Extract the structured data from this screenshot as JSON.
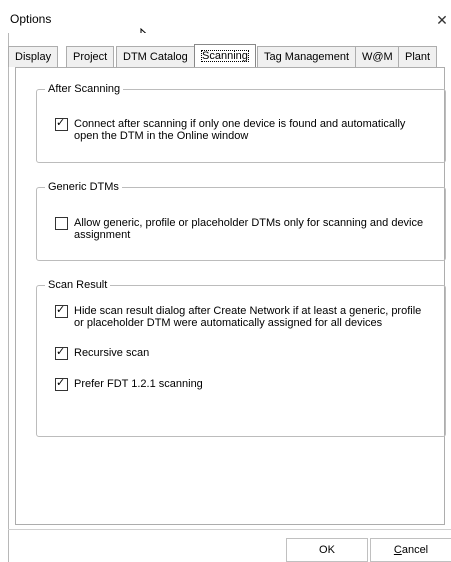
{
  "window": {
    "title": "Options",
    "close_glyph": "✕"
  },
  "tabs": [
    {
      "label": "Display"
    },
    {
      "label": "Project"
    },
    {
      "label": "DTM Catalog"
    },
    {
      "label": "Scanning",
      "active": true
    },
    {
      "label": "Tag Management"
    },
    {
      "label": "W@M"
    },
    {
      "label": "Plant"
    }
  ],
  "groups": {
    "after_scanning": {
      "legend": "After Scanning",
      "options": [
        {
          "line1": "Connect after scanning if only one device is found and automatically",
          "line2": "open the DTM in the Online window",
          "checked": true
        }
      ]
    },
    "generic_dtms": {
      "legend": "Generic DTMs",
      "options": [
        {
          "line1": "Allow generic, profile or placeholder DTMs only for scanning and device",
          "line2": "assignment",
          "checked": false
        }
      ]
    },
    "scan_result": {
      "legend": "Scan Result",
      "options": [
        {
          "line1": "Hide scan result dialog after Create Network if at least a generic, profile",
          "line2": "or placeholder DTM were automatically assigned for all devices",
          "checked": true
        },
        {
          "label": "Recursive scan",
          "checked": true
        },
        {
          "label": "Prefer FDT 1.2.1 scanning",
          "checked": true
        }
      ]
    }
  },
  "buttons": {
    "ok": "OK",
    "cancel_accel": "C",
    "cancel_rest": "ancel"
  },
  "icons": {
    "cursor": "mouse-cursor-arrow"
  }
}
